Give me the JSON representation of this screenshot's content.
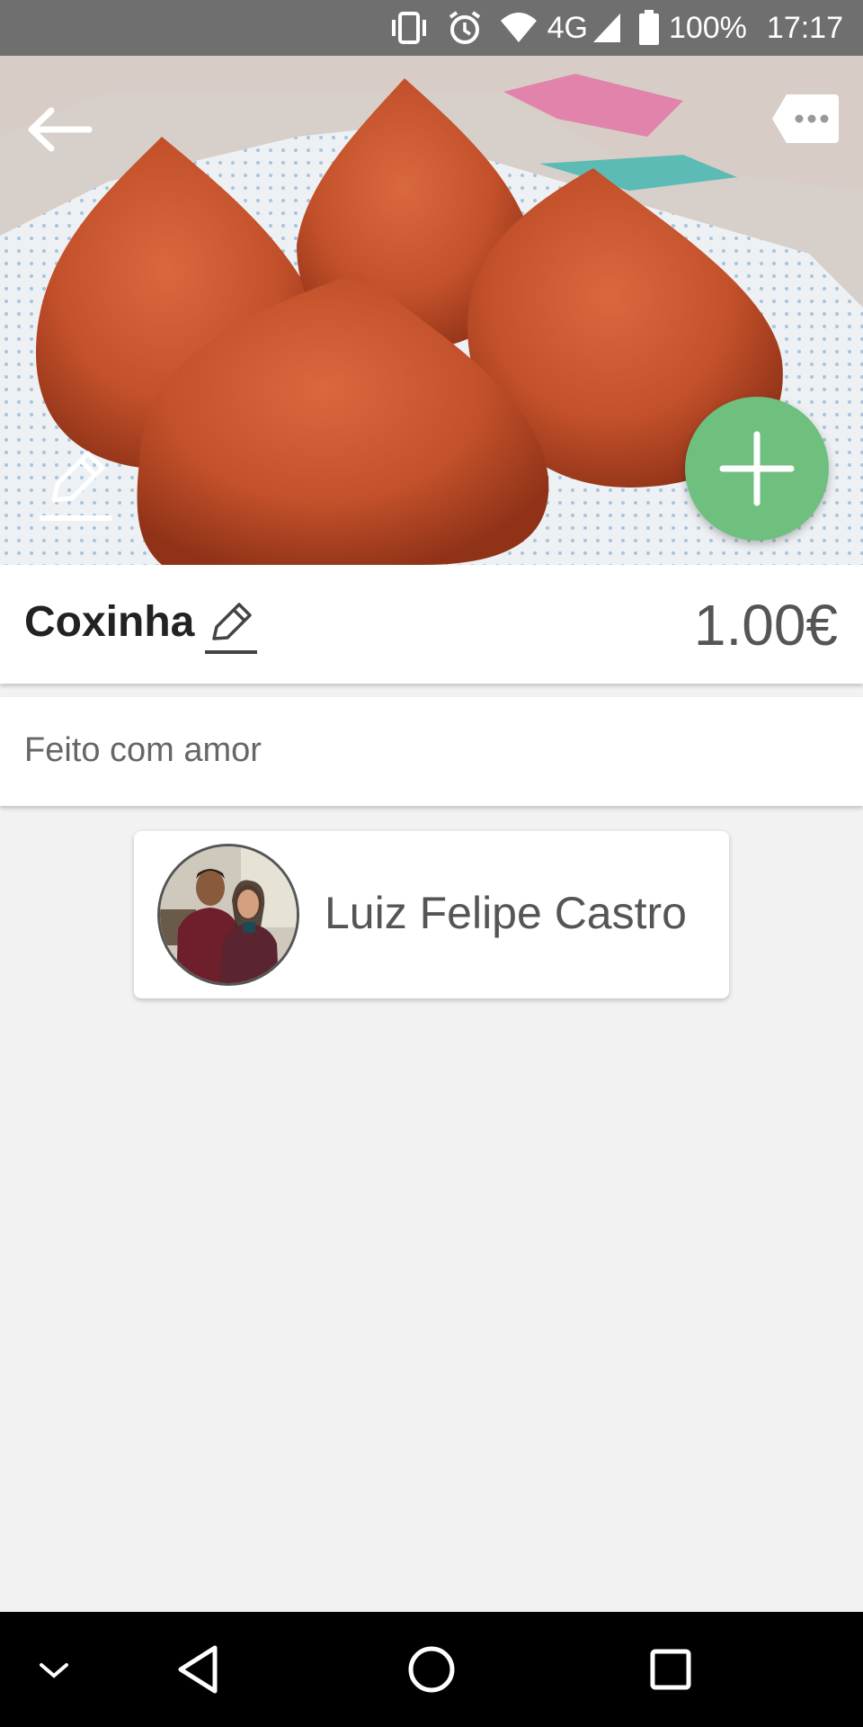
{
  "status_bar": {
    "battery_percent": "100%",
    "time": "17:17",
    "network": "4G",
    "icons": [
      "vibrate-icon",
      "alarm-icon",
      "wifi-icon",
      "signal-icon",
      "battery-icon"
    ]
  },
  "hero": {
    "image_subject": "coxinha-photo",
    "back_icon": "arrow-left-icon",
    "tag_icon": "tag-more-icon",
    "edit_photo_icon": "pencil-icon",
    "fab_icon": "plus-icon"
  },
  "item": {
    "name": "Coxinha",
    "price": "1.00€",
    "description": "Feito com amor"
  },
  "author": {
    "name": "Luiz Felipe Castro"
  },
  "navigation_bar": {
    "icons": [
      "chevron-down-icon",
      "back-triangle-icon",
      "home-circle-icon",
      "recents-square-icon"
    ]
  },
  "colors": {
    "fab": "#6fbf7f",
    "status_bar": "#6f6f6f",
    "background": "#f2f2f2"
  }
}
